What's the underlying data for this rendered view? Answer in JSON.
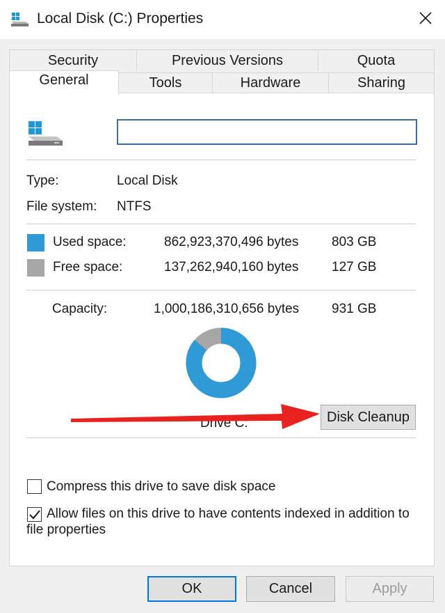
{
  "window": {
    "title": "Local Disk (C:) Properties",
    "icons": {
      "title": "drive-icon",
      "close": "close-icon"
    }
  },
  "tabs": {
    "back_row": [
      "Security",
      "Previous Versions",
      "Quota"
    ],
    "front_row": [
      "General",
      "Tools",
      "Hardware",
      "Sharing"
    ],
    "active": "General"
  },
  "general": {
    "volume_label_value": "",
    "type_label": "Type:",
    "type_value": "Local Disk",
    "fs_label": "File system:",
    "fs_value": "NTFS",
    "used": {
      "label": "Used space:",
      "bytes": "862,923,370,496 bytes",
      "size": "803 GB",
      "color": "#2e9ad6"
    },
    "free": {
      "label": "Free space:",
      "bytes": "137,262,940,160 bytes",
      "size": "127 GB",
      "color": "#a6a6a6"
    },
    "capacity": {
      "label": "Capacity:",
      "bytes": "1,000,186,310,656 bytes",
      "size": "931 GB"
    },
    "used_fraction": 0.863,
    "drive_caption": "Drive C:",
    "disk_cleanup_label": "Disk Cleanup",
    "annotation_color": "#e8231f"
  },
  "options": {
    "compress_label": "Compress this drive to save disk space",
    "compress_checked": false,
    "index_label_line1": "Allow files on this drive to have contents indexed in addition to",
    "index_label_line2": "file properties",
    "index_checked": true
  },
  "footer": {
    "ok_label": "OK",
    "cancel_label": "Cancel",
    "apply_label": "Apply"
  }
}
